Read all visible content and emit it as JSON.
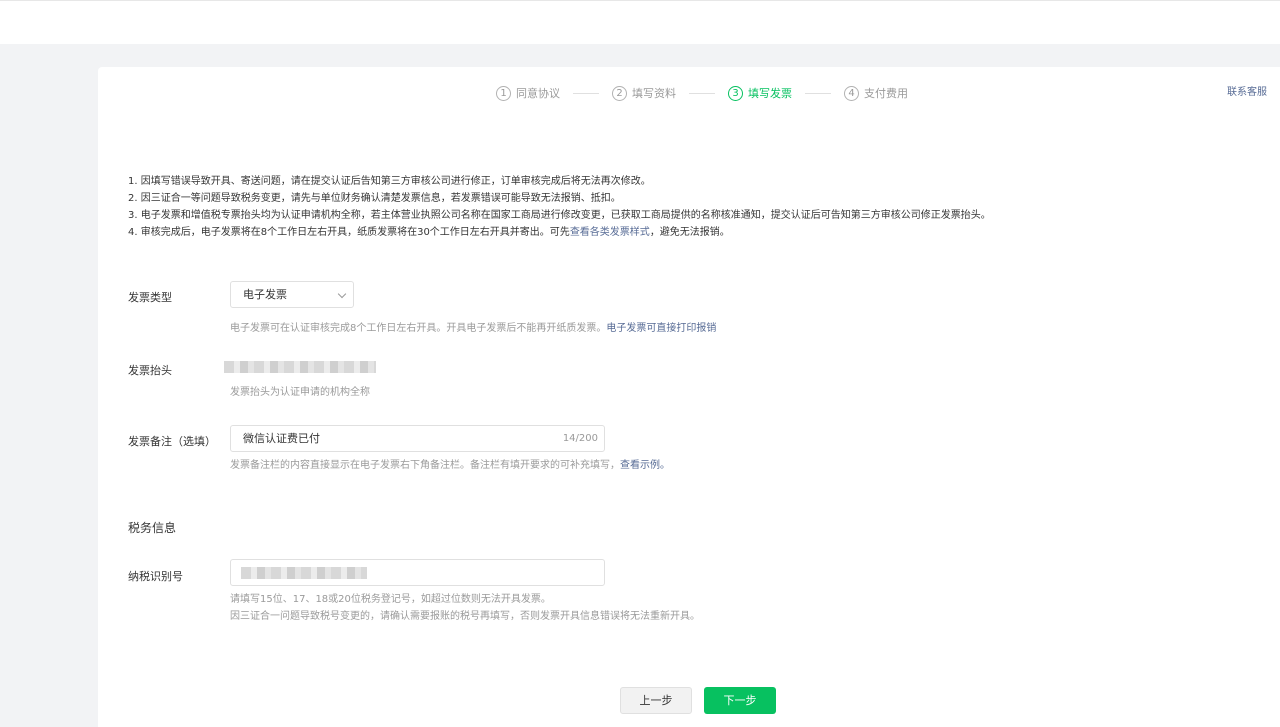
{
  "steps": [
    {
      "num": "1",
      "label": "同意协议",
      "active": false
    },
    {
      "num": "2",
      "label": "填写资料",
      "active": false
    },
    {
      "num": "3",
      "label": "填写发票",
      "active": true
    },
    {
      "num": "4",
      "label": "支付费用",
      "active": false
    }
  ],
  "contact_label": "联系客服",
  "notes": {
    "n1": "1. 因填写错误导致开具、寄送问题，请在提交认证后告知第三方审核公司进行修正，订单审核完成后将无法再次修改。",
    "n2": "2. 因三证合一等问题导致税务变更，请先与单位财务确认清楚发票信息，若发票错误可能导致无法报销、抵扣。",
    "n3": "3. 电子发票和增值税专票抬头均为认证申请机构全称，若主体营业执照公司名称在国家工商局进行修改变更，已获取工商局提供的名称核准通知，提交认证后可告知第三方审核公司修正发票抬头。",
    "n4_prefix": "4. 审核完成后，电子发票将在8个工作日左右开具，纸质发票将在30个工作日左右开具并寄出。可先",
    "n4_link": "查看各类发票样式",
    "n4_suffix": "，避免无法报销。"
  },
  "invoice_type": {
    "label": "发票类型",
    "value": "电子发票",
    "hint_text": "电子发票可在认证审核完成8个工作日左右开具。开具电子发票后不能再开纸质发票。",
    "hint_link": "电子发票可直接打印报销"
  },
  "invoice_title": {
    "label": "发票抬头",
    "hint": "发票抬头为认证申请的机构全称"
  },
  "invoice_remark": {
    "label": "发票备注（选填）",
    "value": "微信认证费已付",
    "counter": "14/200",
    "hint_text": "发票备注栏的内容直接显示在电子发票右下角备注栏。备注栏有填开要求的可补充填写，",
    "hint_link": "查看示例。"
  },
  "tax_section_title": "税务信息",
  "tax_id": {
    "label": "纳税识别号",
    "hint1": "请填写15位、17、18或20位税务登记号，如超过位数则无法开具发票。",
    "hint2": "因三证合一问题导致税号变更的，请确认需要报账的税号再填写，否则发票开具信息错误将无法重新开具。"
  },
  "buttons": {
    "prev": "上一步",
    "next": "下一步"
  },
  "colors": {
    "accent": "#07c160",
    "link": "#576b95"
  }
}
